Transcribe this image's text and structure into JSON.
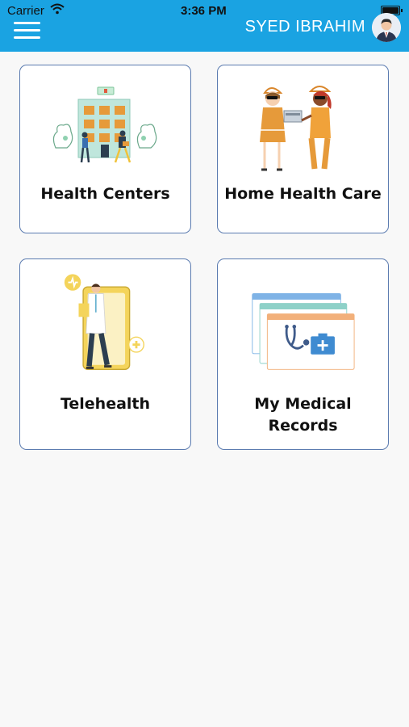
{
  "status_bar": {
    "carrier": "Carrier",
    "time": "3:36 PM"
  },
  "header": {
    "username": "SYED IBRAHIM",
    "accent_color": "#1aa3e2"
  },
  "tiles": [
    {
      "label": "Health Centers",
      "icon": "building-icon"
    },
    {
      "label": "Home Health Care",
      "icon": "nurses-icon"
    },
    {
      "label": "Telehealth",
      "icon": "doctor-phone-icon"
    },
    {
      "label": "My Medical Records",
      "label_lines": [
        "My Medical",
        "Records"
      ],
      "icon": "medical-records-icon"
    }
  ]
}
